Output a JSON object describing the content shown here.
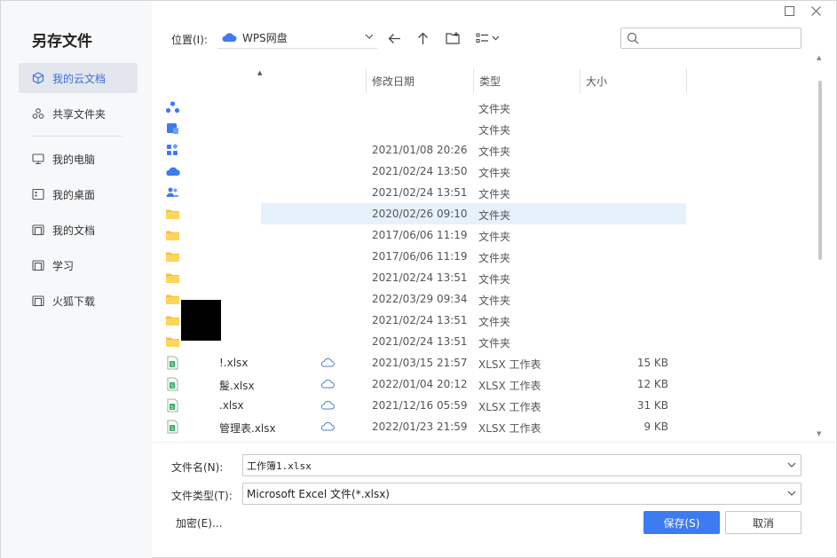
{
  "dialog": {
    "title": "另存文件"
  },
  "sidebar": {
    "items": [
      {
        "label": "我的云文档",
        "icon": "cube-icon",
        "active": true
      },
      {
        "label": "共享文件夹",
        "icon": "share-icon",
        "active": false
      },
      {
        "label": "我的电脑",
        "icon": "monitor-icon",
        "active": false
      },
      {
        "label": "我的桌面",
        "icon": "desktop-icon",
        "active": false
      },
      {
        "label": "我的文档",
        "icon": "folder-outline-icon",
        "active": false
      },
      {
        "label": "学习",
        "icon": "folder-outline-icon",
        "active": false
      },
      {
        "label": "火狐下载",
        "icon": "folder-outline-icon",
        "active": false
      }
    ]
  },
  "toolbar": {
    "location_label": "位置(I):",
    "location_value": "WPS网盘",
    "search_placeholder": ""
  },
  "columns": {
    "date": "修改日期",
    "type": "类型",
    "size": "大小"
  },
  "files": [
    {
      "name": "",
      "date": "",
      "type": "文件夹",
      "size": "",
      "icon": "team-icon"
    },
    {
      "name": "",
      "date": "",
      "type": "文件夹",
      "size": "",
      "icon": "tablet-icon"
    },
    {
      "name": "",
      "date": "2021/01/08 20:26",
      "type": "文件夹",
      "size": "",
      "icon": "apps-icon"
    },
    {
      "name": "",
      "date": "2021/02/24 13:50",
      "type": "文件夹",
      "size": "",
      "icon": "cloud-folder-icon"
    },
    {
      "name": "",
      "date": "2021/02/24 13:51",
      "type": "文件夹",
      "size": "",
      "icon": "people-icon"
    },
    {
      "name": "",
      "date": "2020/02/26 09:10",
      "type": "文件夹",
      "size": "",
      "icon": "folder-icon",
      "selected": true
    },
    {
      "name": "",
      "date": "2017/06/06 11:19",
      "type": "文件夹",
      "size": "",
      "icon": "folder-icon"
    },
    {
      "name": "",
      "date": "2017/06/06 11:19",
      "type": "文件夹",
      "size": "",
      "icon": "folder-icon"
    },
    {
      "name": "",
      "date": "2021/02/24 13:51",
      "type": "文件夹",
      "size": "",
      "icon": "folder-icon"
    },
    {
      "name": "",
      "date": "2022/03/29 09:34",
      "type": "文件夹",
      "size": "",
      "icon": "folder-icon"
    },
    {
      "name": "",
      "date": "2021/02/24 13:51",
      "type": "文件夹",
      "size": "",
      "icon": "folder-icon"
    },
    {
      "name": "",
      "date": "2021/02/24 13:51",
      "type": "文件夹",
      "size": "",
      "icon": "folder-icon"
    },
    {
      "name": "!.xlsx",
      "date": "2021/03/15 21:57",
      "type": "XLSX 工作表",
      "size": "15 KB",
      "icon": "xlsx-icon",
      "cloud": true
    },
    {
      "name": "髲.xlsx",
      "date": "2022/01/04 20:12",
      "type": "XLSX 工作表",
      "size": "12 KB",
      "icon": "xlsx-icon",
      "cloud": true
    },
    {
      "name": ".xlsx",
      "date": "2021/12/16 05:59",
      "type": "XLSX 工作表",
      "size": "31 KB",
      "icon": "xlsx-icon",
      "cloud": true
    },
    {
      "name": "管理表.xlsx",
      "date": "2022/01/23 21:59",
      "type": "XLSX 工作表",
      "size": "9 KB",
      "icon": "xlsx-icon",
      "cloud": true
    }
  ],
  "bottom": {
    "filename_label": "文件名(N):",
    "filename_value": "工作簿1.xlsx",
    "filetype_label": "文件类型(T):",
    "filetype_value": "Microsoft Excel 文件(*.xlsx)",
    "encrypt_label": "加密(E)...",
    "save_label": "保存(S)",
    "cancel_label": "取消"
  },
  "colors": {
    "accent": "#3d7bf0",
    "selected_row": "#e6f1fc",
    "folder": "#f8c033",
    "sidebar_bg": "#f7f8fa"
  }
}
